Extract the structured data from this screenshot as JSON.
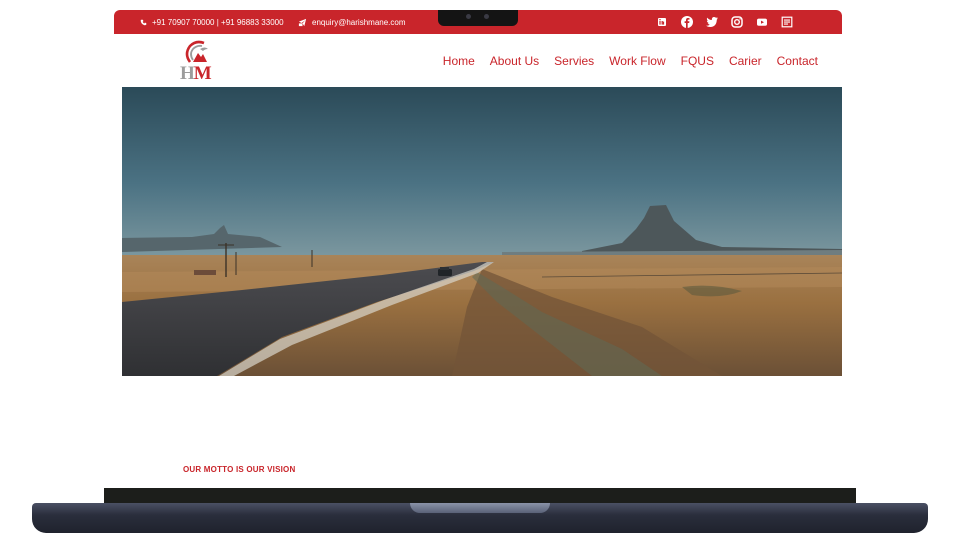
{
  "topbar": {
    "phone": "+91 70907 70000 | +91 96883 33000",
    "email": "enquiry@harishmane.com",
    "social_icons": [
      "linkedin-icon",
      "facebook-icon",
      "twitter-icon",
      "instagram-icon",
      "youtube-icon",
      "blog-icon"
    ]
  },
  "logo": {
    "h": "H",
    "m": "M"
  },
  "nav": {
    "items": [
      "Home",
      "About Us",
      "Servies",
      "Work Flow",
      "FQUS",
      "Carier",
      "Contact"
    ]
  },
  "hero": {
    "image": "desert-highway-photo"
  },
  "section": {
    "motto": "OUR MOTTO IS OUR VISION"
  },
  "colors": {
    "brand_red": "#c9252b",
    "base": "#2a2e3c"
  }
}
